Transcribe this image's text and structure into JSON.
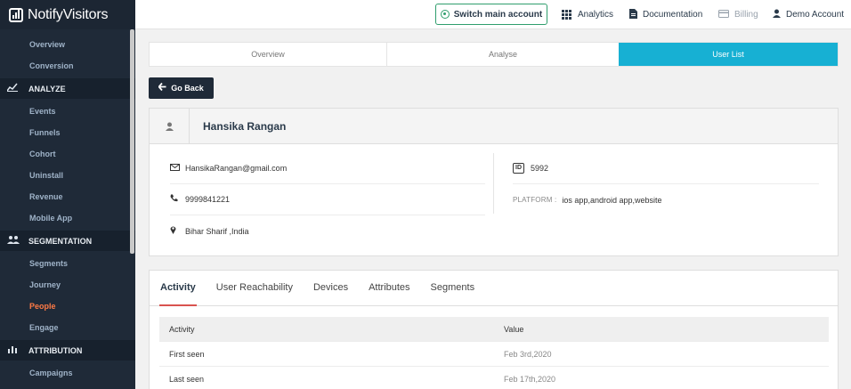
{
  "brand": {
    "name": "NotifyVisitors"
  },
  "sidebar": {
    "top_items": [
      {
        "label": "Overview"
      },
      {
        "label": "Conversion"
      }
    ],
    "analyze": {
      "title": "ANALYZE",
      "items": [
        "Events",
        "Funnels",
        "Cohort",
        "Uninstall",
        "Revenue",
        "Mobile App"
      ]
    },
    "segmentation": {
      "title": "SEGMENTATION",
      "items": [
        "Segments",
        "Journey",
        "People",
        "Engage"
      ],
      "active": "People"
    },
    "attribution": {
      "title": "ATTRIBUTION",
      "items": [
        "Campaigns"
      ]
    }
  },
  "topbar": {
    "switch_label": "Switch main account",
    "analytics_label": "Analytics",
    "documentation_label": "Documentation",
    "billing_label": "Billing",
    "account_label": "Demo Account"
  },
  "tabs": [
    "Overview",
    "Analyse",
    "User List"
  ],
  "active_tab": "User List",
  "go_back_label": "Go Back",
  "profile": {
    "name": "Hansika Rangan",
    "email": "HansikaRangan@gmail.com",
    "phone": "9999841221",
    "location": "Bihar Sharif ,India",
    "id_label": "ID",
    "id_value": "5992",
    "platform_label": "PLATFORM :",
    "platform_value": "ios app,android app,website"
  },
  "detail_tabs": [
    "Activity",
    "User Reachability",
    "Devices",
    "Attributes",
    "Segments"
  ],
  "activity_table": {
    "headers": [
      "Activity",
      "Value"
    ],
    "rows": [
      [
        "First seen",
        "Feb 3rd,2020"
      ],
      [
        "Last seen",
        "Feb 17th,2020"
      ]
    ]
  },
  "colors": {
    "accent": "#17b0d3",
    "sidebar": "#1f2a38",
    "active_link": "#ff7a45",
    "tab_underline": "#d9534f",
    "switch_border": "#2f9e6d"
  }
}
